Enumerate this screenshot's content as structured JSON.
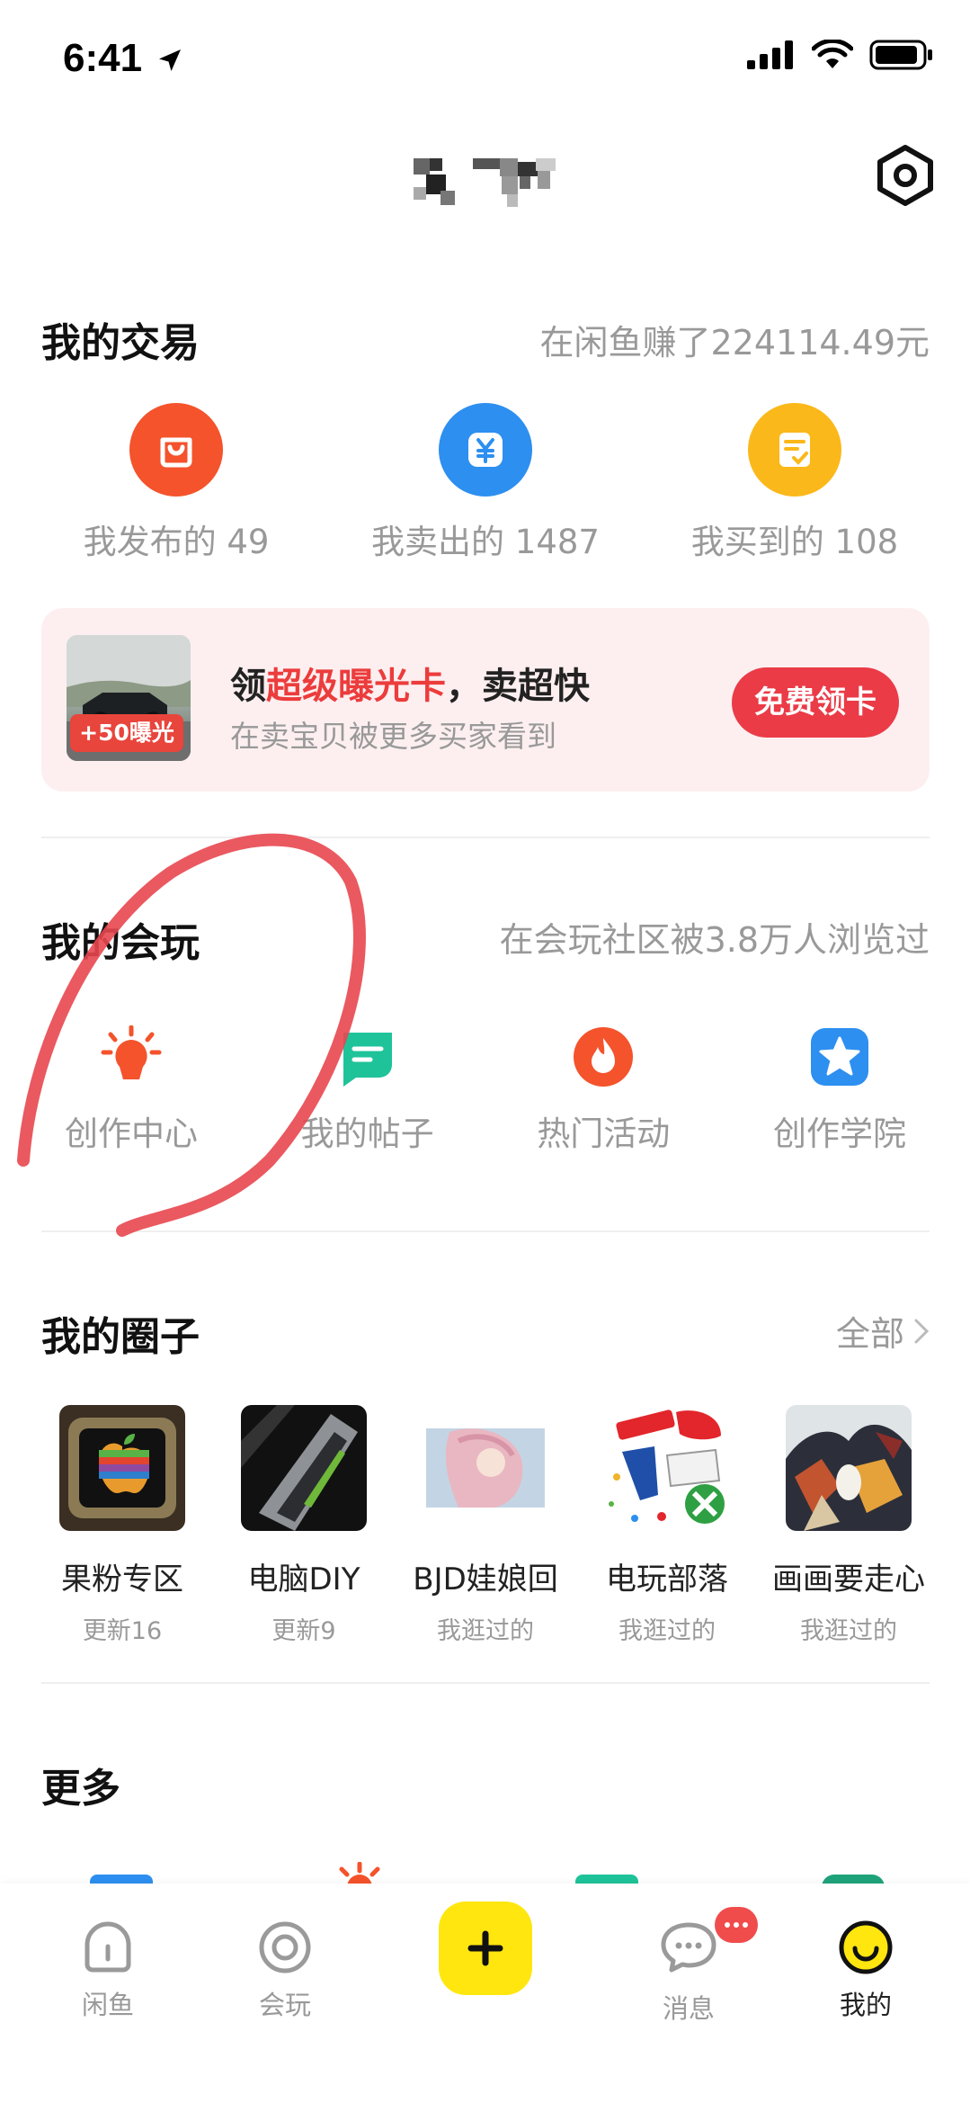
{
  "status": {
    "time": "6:41"
  },
  "trade": {
    "title": "我的交易",
    "earned": "在闲鱼赚了224114.49元",
    "items": [
      {
        "label": "我发布的 49",
        "color": "#f4532c"
      },
      {
        "label": "我卖出的 1487",
        "color": "#2d8ff0"
      },
      {
        "label": "我买到的 108",
        "color": "#fbb81a"
      }
    ]
  },
  "promo": {
    "badge": "+50曝光",
    "title_pre": "领",
    "title_highlight": "超级曝光卡",
    "title_post": "，卖超快",
    "subtitle": "在卖宝贝被更多买家看到",
    "button": "免费领卡"
  },
  "play": {
    "title": "我的会玩",
    "stats": "在会玩社区被3.8万人浏览过",
    "items": [
      {
        "label": "创作中心",
        "icon": "lightbulb-icon",
        "color": "#f4532c"
      },
      {
        "label": "我的帖子",
        "icon": "note-icon",
        "color": "#1fc39a"
      },
      {
        "label": "热门活动",
        "icon": "flame-icon",
        "color": "#f4532c"
      },
      {
        "label": "创作学院",
        "icon": "star-icon",
        "color": "#2d8ff0"
      }
    ]
  },
  "circles": {
    "title": "我的圈子",
    "all": "全部",
    "items": [
      {
        "name": "果粉专区",
        "note": "更新16"
      },
      {
        "name": "电脑DIY",
        "note": "更新9"
      },
      {
        "name": "BJD娃娘回",
        "note": "我逛过的"
      },
      {
        "name": "电玩部落",
        "note": "我逛过的"
      },
      {
        "name": "画画要走心",
        "note": "我逛过的"
      }
    ]
  },
  "more": {
    "title": "更多"
  },
  "tabbar": {
    "items": [
      {
        "label": "闲鱼",
        "icon": "home-icon"
      },
      {
        "label": "会玩",
        "icon": "target-icon"
      },
      {
        "label": "消息",
        "icon": "chat-icon"
      },
      {
        "label": "我的",
        "icon": "smiley-icon"
      }
    ],
    "accent": "#ffe60f"
  },
  "annotation_color": "#e8474f"
}
